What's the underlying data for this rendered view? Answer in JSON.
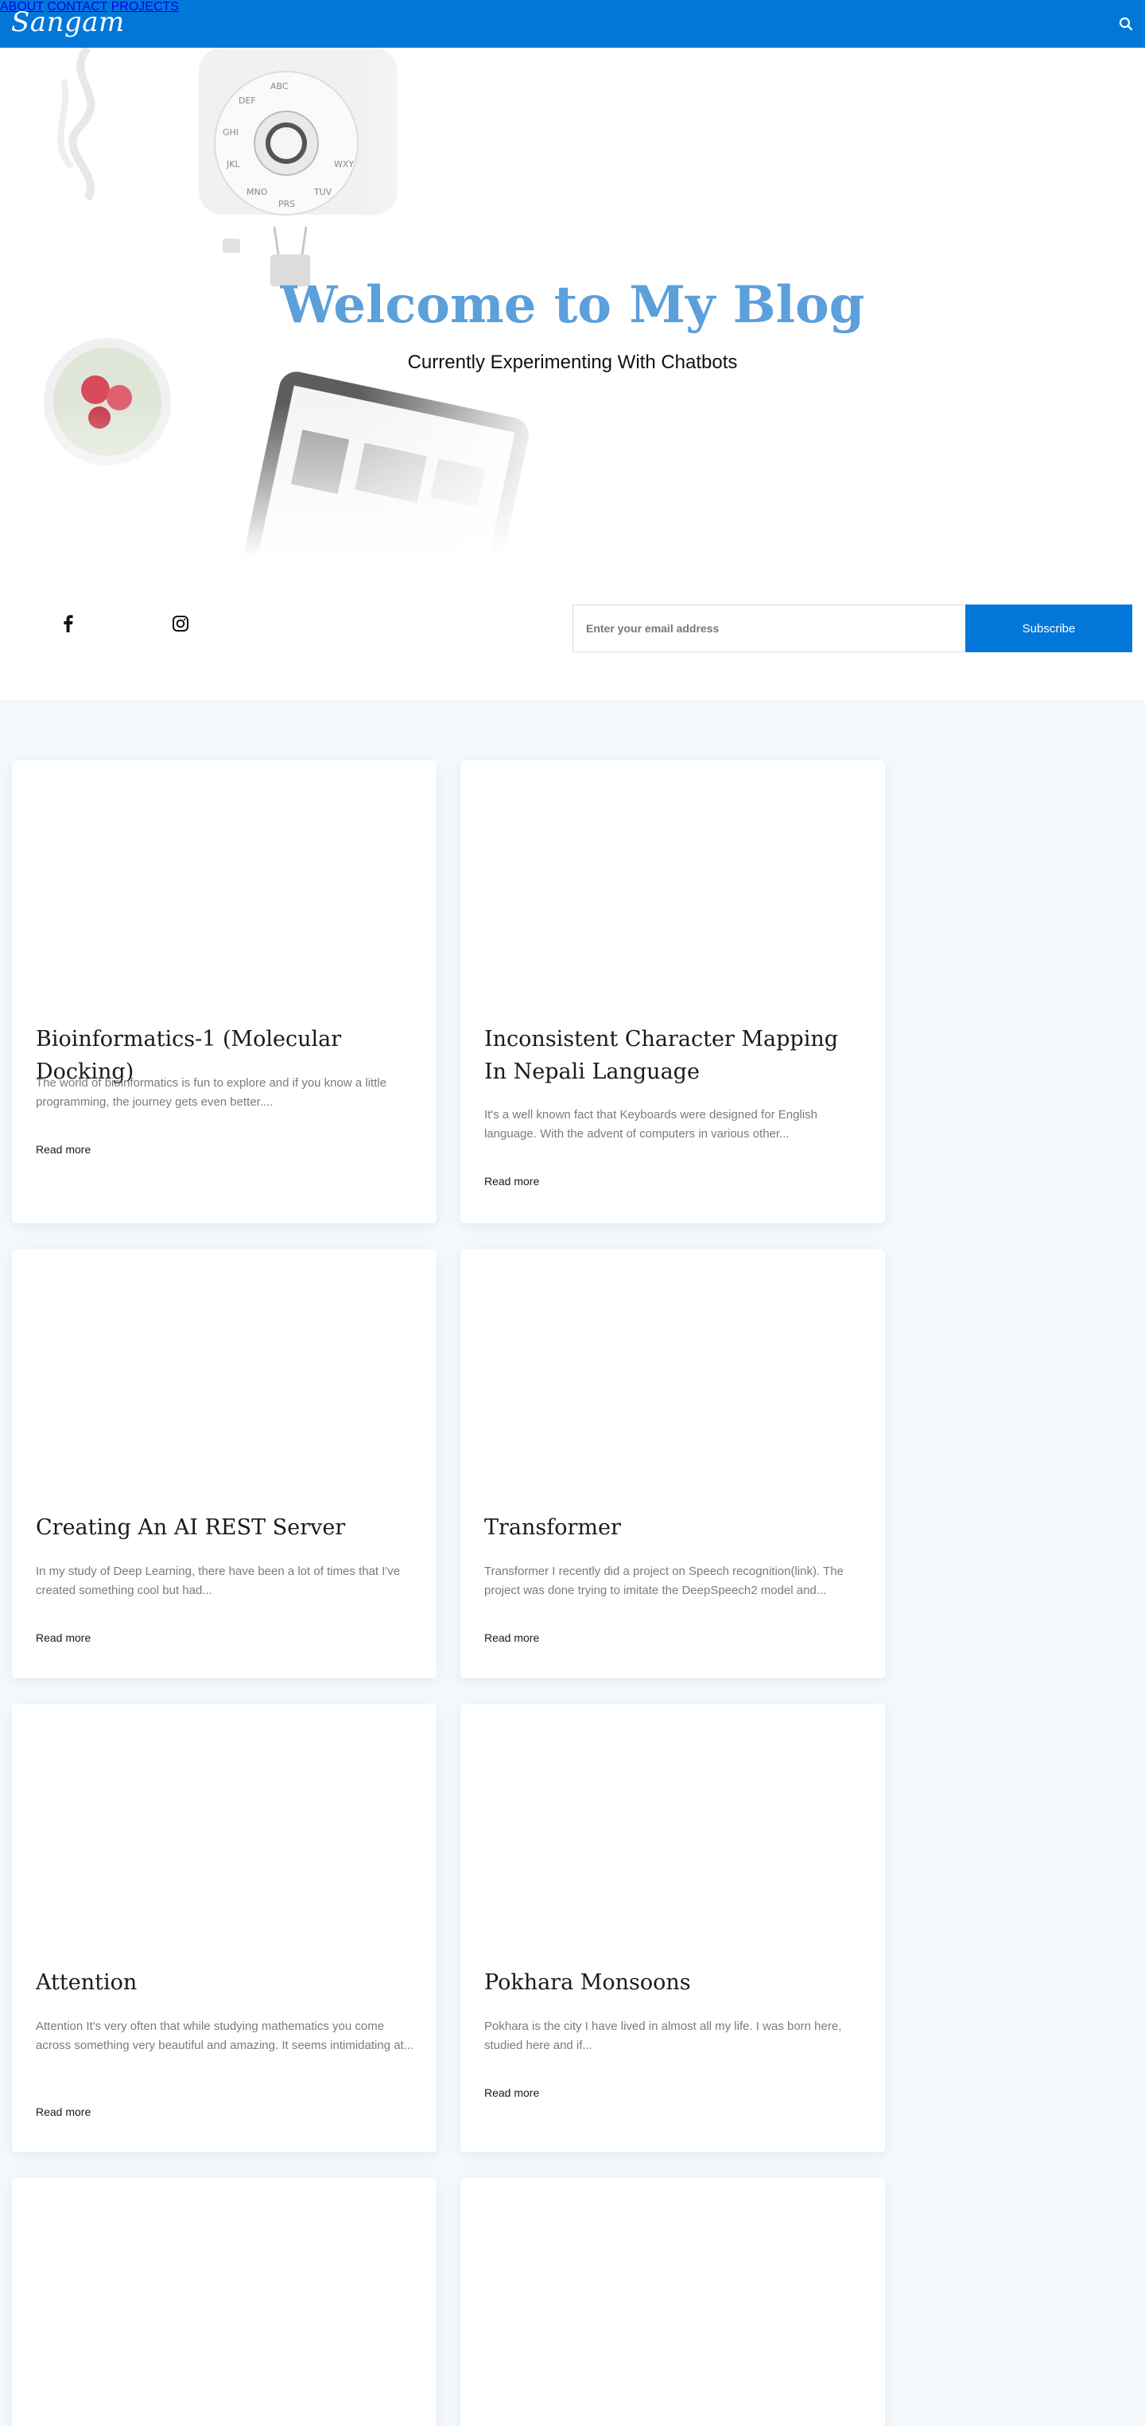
{
  "header": {
    "logo": "Sangam",
    "nav": [
      {
        "label": "ABOUT"
      },
      {
        "label": "CONTACT"
      },
      {
        "label": "PROJECTS"
      }
    ],
    "search_icon": "search-icon"
  },
  "hero": {
    "title": "Welcome to My Blog",
    "subtitle": "Currently Experimenting With Chatbots"
  },
  "social": [
    {
      "icon": "facebook-icon"
    },
    {
      "icon": "instagram-icon"
    }
  ],
  "subscribe": {
    "placeholder": "Enter your email address",
    "button": "Subscribe"
  },
  "posts": [
    {
      "title": "Bioinformatics-1 (Molecular Docking)",
      "excerpt": "The world of bioinformatics is fun to explore and if you know a little programming, the journey gets even better....",
      "read_more": "Read more"
    },
    {
      "title": "Inconsistent Character Mapping In Nepali Language",
      "excerpt": "It's a well known fact that Keyboards were designed for English language. With the advent of computers in various other...",
      "read_more": "Read more"
    },
    {
      "title": "Creating An AI REST Server",
      "excerpt": "In my study of Deep Learning, there have been a lot of times that I've created something cool but had...",
      "read_more": "Read more"
    },
    {
      "title": "Transformer",
      "excerpt": "Transformer  I recently did a project on Speech recognition(link). The project was done trying to imitate the DeepSpeech2 model and...",
      "read_more": "Read more"
    },
    {
      "title": "Attention",
      "excerpt": "Attention It's very often that while studying mathematics you come across something very beautiful and amazing. It seems intimidating at...",
      "read_more": "Read more"
    },
    {
      "title": "Pokhara Monsoons",
      "excerpt": "Pokhara is the city I have lived in almost all my life. I was born here, studied here and if...",
      "read_more": "Read more"
    }
  ],
  "colors": {
    "brand": "#0277d9",
    "hero_title": "#5b9fdb",
    "section_bg": "#f3f8fc"
  }
}
